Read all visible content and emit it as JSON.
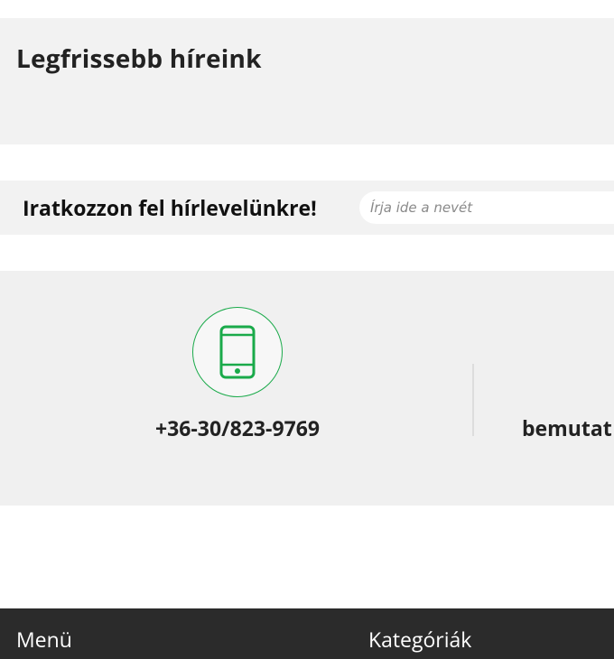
{
  "news": {
    "title": "Legfrissebb híreink"
  },
  "newsletter": {
    "title": "Iratkozzon fel hírlevelünkre!",
    "name_placeholder": "Írja ide a nevét"
  },
  "contact": {
    "icon": "smartphone-icon",
    "phone": "+36-30/823-9769",
    "demo_label_partial": "bemutat"
  },
  "footer": {
    "menu_heading": "Menü",
    "categories_heading": "Kategóriák"
  },
  "colors": {
    "accent_green": "#1aaa4a",
    "section_bg": "#f2f2f2",
    "footer_bg": "#2b2b2b"
  }
}
